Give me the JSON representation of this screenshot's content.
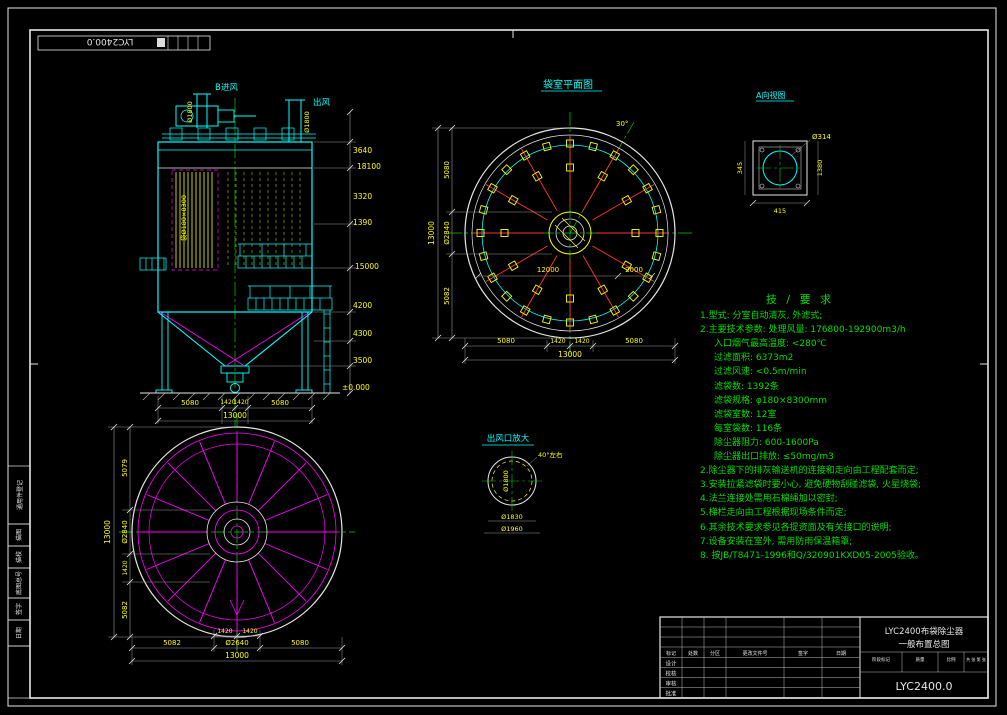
{
  "drawing": {
    "corner_label": "LYC2400.0",
    "left_strip": [
      "通用件登记",
      "描图",
      "描校",
      "底图总号",
      "签字",
      "日期"
    ]
  },
  "front_view": {
    "inlet_label": "B进风",
    "inlet_dia": "Ø1800",
    "outlet_label": "出风",
    "outlet_dia": "Ø1800",
    "bag_size_label": "袋Ø180×8300",
    "dims_right": [
      "3640",
      "18100",
      "3320",
      "1390",
      "15000",
      "4200",
      "4300",
      "3500"
    ],
    "ground_level": "±0.000",
    "dims_bottom": [
      "5080",
      "1420",
      "1420",
      "5080"
    ],
    "dim_overall_width": "13000"
  },
  "plan_view": {
    "title": "袋室平面图",
    "angle_label": "30°",
    "dim_left_overall": "13000",
    "dims_left": [
      "5080",
      "Ø2840",
      "5082"
    ],
    "dims_inner": [
      "12000",
      "2000"
    ],
    "dims_bottom": [
      "5080",
      "1420",
      "1420",
      "5080"
    ],
    "dim_bottom_overall": "13000"
  },
  "detail_a": {
    "title": "A向视图",
    "dim_top": "Ø314",
    "dim_left": "345",
    "dim_right": "1380",
    "dim_bottom": "415"
  },
  "tech": {
    "title": "技 / 要 求",
    "lines": [
      "1.型式: 分室自动清灰, 外滤式;",
      "2.主要技术参数: 处理风量: 176800-192900m3/h",
      "入口烟气最高温度: <280℃",
      "过滤面积:  6373m2",
      "过滤风速:  <0.5m/min",
      "滤袋数:  1392条",
      "滤袋规格:  φ180×8300mm",
      "滤袋室数:  12室",
      "每室袋数:  116条",
      "除尘器阻力:  600-1600Pa",
      "除尘器出口排放: ≤50mg/m3",
      "2.除尘器下的排灰输送机的连接和走向由工程配套而定;",
      "3.安装拉紧滤袋时要小心, 避免硬物刮碰滤袋, 火星烧袋;",
      "4.法兰连接处需用石棉绳加以密封;",
      "5.梯栏走向由工程根据现场条件而定;",
      "6.其余技术要求参见各提资面及有关接口的说明;",
      "7.设备安装在室外, 需用防雨保温箱罩;",
      "8. 按JB/T8471-1996和Q/320901KXD05-2005验收。"
    ]
  },
  "bottom_plan": {
    "dim_left_overall": "13000",
    "dims_left": [
      "5079",
      "Ø2840",
      "1420",
      "5082"
    ],
    "dims_bottom_row1": [
      "1420",
      "1420"
    ],
    "dims_bottom_row2": [
      "5082",
      "Ø2640",
      "5080"
    ],
    "dim_bottom_overall": "13000"
  },
  "outlet_detail": {
    "title": "出风口放大",
    "note": "40°左右",
    "dia_inner": "Ø1800",
    "dia_mid": "Ø1830",
    "dia_outer": "Ø1960"
  },
  "title_block": {
    "rev_headers": [
      "标记",
      "处数",
      "分区",
      "更改文件号",
      "签字",
      "日期"
    ],
    "sig_labels": [
      "设计",
      "校核",
      "审核",
      "批准"
    ],
    "stage_labels": [
      "阶段标记",
      "质量",
      "比例"
    ],
    "sheet_label": "共 张 第 张",
    "product": "LYC2400布袋除尘器",
    "drawing_name": "一般布置总图",
    "drawing_no": "LYC2400.0"
  }
}
